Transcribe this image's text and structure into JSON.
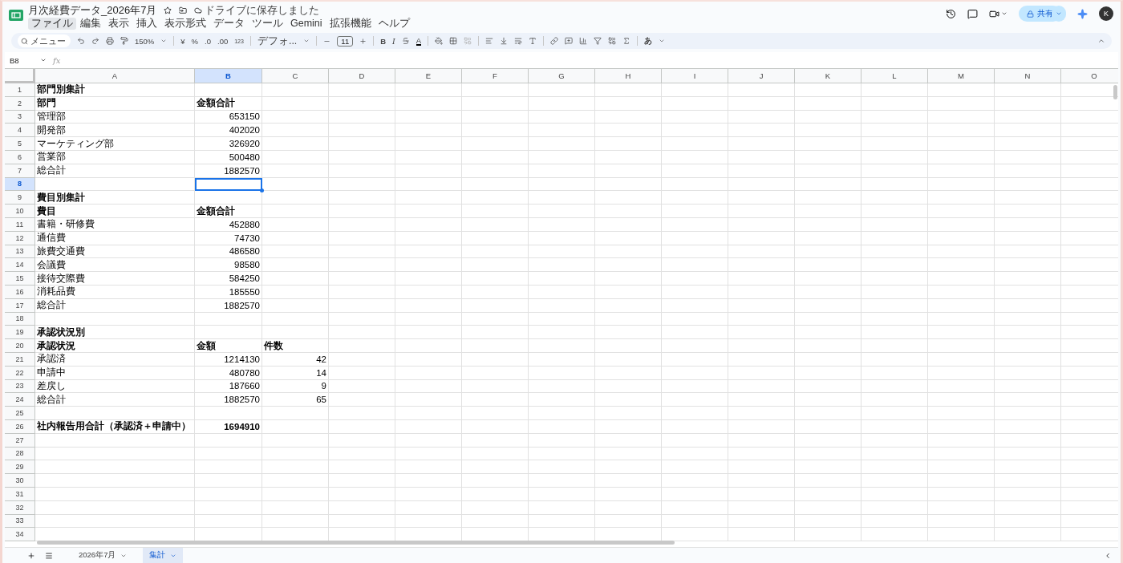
{
  "document": {
    "title": "月次経費データ_2026年7月",
    "save_status": "ドライブに保存しました"
  },
  "menu": [
    {
      "label": "ファイル",
      "selected": true
    },
    {
      "label": "編集",
      "selected": false
    },
    {
      "label": "表示",
      "selected": false
    },
    {
      "label": "挿入",
      "selected": false
    },
    {
      "label": "表示形式",
      "selected": false
    },
    {
      "label": "データ",
      "selected": false
    },
    {
      "label": "ツール",
      "selected": false
    },
    {
      "label": "Gemini",
      "selected": false
    },
    {
      "label": "拡張機能",
      "selected": false
    },
    {
      "label": "ヘルプ",
      "selected": false
    }
  ],
  "header": {
    "share": "共有",
    "avatar": "K"
  },
  "toolbar": {
    "search": "メニュー",
    "zoom": "150%",
    "currency": "¥",
    "percent": "%",
    "decrease_decimal": ".0",
    "increase_decimal": ".00",
    "number_format": "123",
    "font": "デフォ...",
    "font_size": "11",
    "bold": "B",
    "italic": "I",
    "text_color": "A",
    "input_tools": "あ"
  },
  "formula_bar": {
    "name_box": "B8",
    "fx_label": "fx"
  },
  "columns": [
    {
      "label": "A",
      "selected": false
    },
    {
      "label": "B",
      "selected": true
    },
    {
      "label": "C",
      "selected": false
    },
    {
      "label": "D",
      "selected": false
    },
    {
      "label": "E",
      "selected": false
    },
    {
      "label": "F",
      "selected": false
    },
    {
      "label": "G",
      "selected": false
    },
    {
      "label": "H",
      "selected": false
    },
    {
      "label": "I",
      "selected": false
    },
    {
      "label": "J",
      "selected": false
    },
    {
      "label": "K",
      "selected": false
    },
    {
      "label": "L",
      "selected": false
    },
    {
      "label": "M",
      "selected": false
    },
    {
      "label": "N",
      "selected": false
    },
    {
      "label": "O",
      "selected": false
    }
  ],
  "rows": [
    {
      "number": "1",
      "selected": false,
      "cells": [
        {
          "kind": "text",
          "text": "部門別集計",
          "bold": true
        }
      ]
    },
    {
      "number": "2",
      "selected": false,
      "cells": [
        {
          "kind": "text",
          "text": "部門",
          "bold": true
        },
        {
          "kind": "text",
          "text": "金額合計",
          "bold": true
        }
      ]
    },
    {
      "number": "3",
      "selected": false,
      "cells": [
        {
          "kind": "text",
          "text": "管理部",
          "bold": false
        },
        {
          "kind": "number",
          "text": "653150",
          "bold": false
        }
      ]
    },
    {
      "number": "4",
      "selected": false,
      "cells": [
        {
          "kind": "text",
          "text": "開発部",
          "bold": false
        },
        {
          "kind": "number",
          "text": "402020",
          "bold": false
        }
      ]
    },
    {
      "number": "5",
      "selected": false,
      "cells": [
        {
          "kind": "text",
          "text": "マーケティング部",
          "bold": false
        },
        {
          "kind": "number",
          "text": "326920",
          "bold": false
        }
      ]
    },
    {
      "number": "6",
      "selected": false,
      "cells": [
        {
          "kind": "text",
          "text": "営業部",
          "bold": false
        },
        {
          "kind": "number",
          "text": "500480",
          "bold": false
        }
      ]
    },
    {
      "number": "7",
      "selected": false,
      "cells": [
        {
          "kind": "text",
          "text": "総合計",
          "bold": false
        },
        {
          "kind": "number",
          "text": "1882570",
          "bold": false
        }
      ]
    },
    {
      "number": "8",
      "selected": true,
      "cells": []
    },
    {
      "number": "9",
      "selected": false,
      "cells": [
        {
          "kind": "text",
          "text": "費目別集計",
          "bold": true
        }
      ]
    },
    {
      "number": "10",
      "selected": false,
      "cells": [
        {
          "kind": "text",
          "text": "費目",
          "bold": true
        },
        {
          "kind": "text",
          "text": "金額合計",
          "bold": true
        }
      ]
    },
    {
      "number": "11",
      "selected": false,
      "cells": [
        {
          "kind": "text",
          "text": "書籍・研修費",
          "bold": false
        },
        {
          "kind": "number",
          "text": "452880",
          "bold": false
        }
      ]
    },
    {
      "number": "12",
      "selected": false,
      "cells": [
        {
          "kind": "text",
          "text": "通信費",
          "bold": false
        },
        {
          "kind": "number",
          "text": "74730",
          "bold": false
        }
      ]
    },
    {
      "number": "13",
      "selected": false,
      "cells": [
        {
          "kind": "text",
          "text": "旅費交通費",
          "bold": false
        },
        {
          "kind": "number",
          "text": "486580",
          "bold": false
        }
      ]
    },
    {
      "number": "14",
      "selected": false,
      "cells": [
        {
          "kind": "text",
          "text": "会議費",
          "bold": false
        },
        {
          "kind": "number",
          "text": "98580",
          "bold": false
        }
      ]
    },
    {
      "number": "15",
      "selected": false,
      "cells": [
        {
          "kind": "text",
          "text": "接待交際費",
          "bold": false
        },
        {
          "kind": "number",
          "text": "584250",
          "bold": false
        }
      ]
    },
    {
      "number": "16",
      "selected": false,
      "cells": [
        {
          "kind": "text",
          "text": "消耗品費",
          "bold": false
        },
        {
          "kind": "number",
          "text": "185550",
          "bold": false
        }
      ]
    },
    {
      "number": "17",
      "selected": false,
      "cells": [
        {
          "kind": "text",
          "text": "総合計",
          "bold": false
        },
        {
          "kind": "number",
          "text": "1882570",
          "bold": false
        }
      ]
    },
    {
      "number": "18",
      "selected": false,
      "cells": []
    },
    {
      "number": "19",
      "selected": false,
      "cells": [
        {
          "kind": "text",
          "text": "承認状況別",
          "bold": true
        }
      ]
    },
    {
      "number": "20",
      "selected": false,
      "cells": [
        {
          "kind": "text",
          "text": "承認状況",
          "bold": true
        },
        {
          "kind": "text",
          "text": "金額",
          "bold": true
        },
        {
          "kind": "text",
          "text": "件数",
          "bold": true
        }
      ]
    },
    {
      "number": "21",
      "selected": false,
      "cells": [
        {
          "kind": "text",
          "text": "承認済",
          "bold": false
        },
        {
          "kind": "number",
          "text": "1214130",
          "bold": false
        },
        {
          "kind": "number",
          "text": "42",
          "bold": false
        }
      ]
    },
    {
      "number": "22",
      "selected": false,
      "cells": [
        {
          "kind": "text",
          "text": "申請中",
          "bold": false
        },
        {
          "kind": "number",
          "text": "480780",
          "bold": false
        },
        {
          "kind": "number",
          "text": "14",
          "bold": false
        }
      ]
    },
    {
      "number": "23",
      "selected": false,
      "cells": [
        {
          "kind": "text",
          "text": "差戻し",
          "bold": false
        },
        {
          "kind": "number",
          "text": "187660",
          "bold": false
        },
        {
          "kind": "number",
          "text": "9",
          "bold": false
        }
      ]
    },
    {
      "number": "24",
      "selected": false,
      "cells": [
        {
          "kind": "text",
          "text": "総合計",
          "bold": false
        },
        {
          "kind": "number",
          "text": "1882570",
          "bold": false
        },
        {
          "kind": "number",
          "text": "65",
          "bold": false
        }
      ]
    },
    {
      "number": "25",
      "selected": false,
      "cells": []
    },
    {
      "number": "26",
      "selected": false,
      "cells": [
        {
          "kind": "text",
          "text": "社内報告用合計（承認済＋申請中）",
          "bold": true
        },
        {
          "kind": "number",
          "text": "1694910",
          "bold": true
        }
      ]
    },
    {
      "number": "27",
      "selected": false,
      "cells": []
    },
    {
      "number": "28",
      "selected": false,
      "cells": []
    },
    {
      "number": "29",
      "selected": false,
      "cells": []
    },
    {
      "number": "30",
      "selected": false,
      "cells": []
    },
    {
      "number": "31",
      "selected": false,
      "cells": []
    },
    {
      "number": "32",
      "selected": false,
      "cells": []
    },
    {
      "number": "33",
      "selected": false,
      "cells": []
    },
    {
      "number": "34",
      "selected": false,
      "cells": []
    }
  ],
  "sheet_tabs": [
    {
      "label": "2026年7月",
      "selected": false
    },
    {
      "label": "集計",
      "selected": true
    }
  ]
}
